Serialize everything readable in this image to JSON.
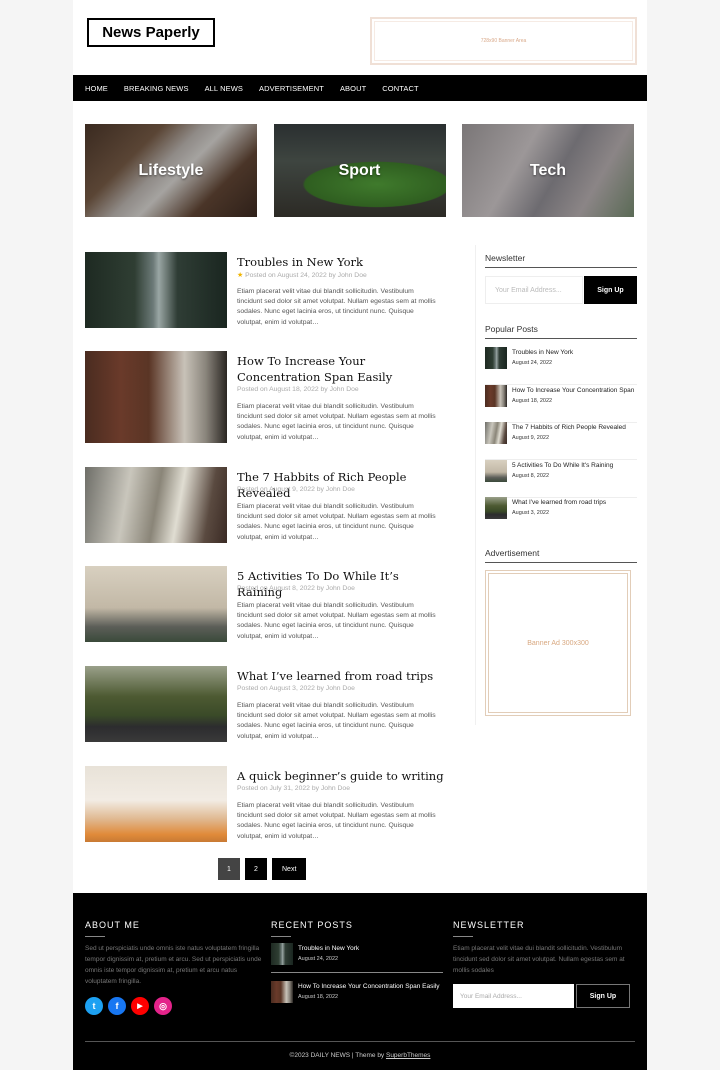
{
  "header": {
    "logo": "News Paperly",
    "banner_text": "728x90 Banner Area"
  },
  "nav": {
    "items": [
      "HOME",
      "BREAKING NEWS",
      "ALL NEWS",
      "ADVERTISEMENT",
      "ABOUT",
      "CONTACT"
    ]
  },
  "categories": [
    {
      "label": "Lifestyle"
    },
    {
      "label": "Sport"
    },
    {
      "label": "Tech"
    }
  ],
  "posts": [
    {
      "title": "Troubles in New York",
      "meta": "Posted on August 24, 2022 by John Doe",
      "featured": true,
      "excerpt": "Etiam placerat velit vitae dui blandit sollicitudin. Vestibulum tincidunt sed dolor sit amet volutpat. Nullam egestas sem at mollis sodales. Nunc eget lacinia eros, ut tincidunt nunc. Quisque volutpat, enim id volutpat…"
    },
    {
      "title": "How To Increase Your Concentration Span Easily",
      "meta": "Posted on August 18, 2022 by John Doe",
      "featured": false,
      "excerpt": "Etiam placerat velit vitae dui blandit sollicitudin. Vestibulum tincidunt sed dolor sit amet volutpat. Nullam egestas sem at mollis sodales. Nunc eget lacinia eros, ut tincidunt nunc. Quisque volutpat, enim id volutpat…"
    },
    {
      "title": "The 7 Habbits of Rich People Revealed",
      "meta": "Posted on August 9, 2022 by John Doe",
      "featured": false,
      "excerpt": "Etiam placerat velit vitae dui blandit sollicitudin. Vestibulum tincidunt sed dolor sit amet volutpat. Nullam egestas sem at mollis sodales. Nunc eget lacinia eros, ut tincidunt nunc. Quisque volutpat, enim id volutpat…"
    },
    {
      "title": "5 Activities To Do While It’s Raining",
      "meta": "Posted on August 8, 2022 by John Doe",
      "featured": false,
      "excerpt": "Etiam placerat velit vitae dui blandit sollicitudin. Vestibulum tincidunt sed dolor sit amet volutpat. Nullam egestas sem at mollis sodales. Nunc eget lacinia eros, ut tincidunt nunc. Quisque volutpat, enim id volutpat…"
    },
    {
      "title": "What I’ve learned from road trips",
      "meta": "Posted on August 3, 2022 by John Doe",
      "featured": false,
      "excerpt": "Etiam placerat velit vitae dui blandit sollicitudin. Vestibulum tincidunt sed dolor sit amet volutpat. Nullam egestas sem at mollis sodales. Nunc eget lacinia eros, ut tincidunt nunc. Quisque volutpat, enim id volutpat…"
    },
    {
      "title": "A quick beginner’s guide to writing",
      "meta": "Posted on July 31, 2022 by John Doe",
      "featured": false,
      "excerpt": "Etiam placerat velit vitae dui blandit sollicitudin. Vestibulum tincidunt sed dolor sit amet volutpat. Nullam egestas sem at mollis sodales. Nunc eget lacinia eros, ut tincidunt nunc. Quisque volutpat, enim id volutpat…"
    }
  ],
  "pagination": {
    "pages": [
      "1",
      "2"
    ],
    "current": "1",
    "next_label": "Next"
  },
  "sidebar": {
    "newsletter": {
      "title": "Newsletter",
      "placeholder": "Your Email Address...",
      "button": "Sign Up"
    },
    "popular": {
      "title": "Popular Posts",
      "items": [
        {
          "title": "Troubles in New York",
          "date": "August 24, 2022"
        },
        {
          "title": "How To Increase Your Concentration Span",
          "date": "August 18, 2022"
        },
        {
          "title": "The 7 Habbits of Rich People Revealed",
          "date": "August 9, 2022"
        },
        {
          "title": "5 Activities To Do While It's Raining",
          "date": "August 8, 2022"
        },
        {
          "title": "What I've learned from road trips",
          "date": "August 3, 2022"
        }
      ]
    },
    "advertisement": {
      "title": "Advertisement",
      "text": "Banner Ad 300x300"
    }
  },
  "footer": {
    "about": {
      "title": "ABOUT ME",
      "text": "Sed ut perspiciatis unde omnis iste natus voluptatem fringilla tempor dignissim at, pretium et arcu. Sed ut perspiciatis unde omnis iste tempor dignissim at, pretium et arcu natus voluptatem fringilla."
    },
    "socials": [
      {
        "name": "twitter",
        "glyph": "t"
      },
      {
        "name": "facebook",
        "glyph": "f"
      },
      {
        "name": "youtube",
        "glyph": "▶"
      },
      {
        "name": "instagram",
        "glyph": "◎"
      }
    ],
    "recent": {
      "title": "RECENT POSTS",
      "items": [
        {
          "title": "Troubles in New York",
          "date": "August 24, 2022"
        },
        {
          "title": "How To Increase Your Concentration Span Easily",
          "date": "August 18, 2022"
        }
      ]
    },
    "newsletter": {
      "title": "NEWSLETTER",
      "text": "Etiam placerat velit vitae dui blandit sollicitudin. Vestibulum tincidunt sed dolor sit amet volutpat. Nullam egestas sem at mollis sodales",
      "placeholder": "Your Email Address...",
      "button": "Sign Up"
    },
    "copyright_prefix": "©2023 DAILY NEWS | Theme by ",
    "copyright_link": "SuperbThemes"
  },
  "colors": {
    "accent_star": "#f0b400",
    "banner_text": "#d9a98a",
    "twitter": "#1da1f2",
    "facebook": "#1877f2",
    "youtube": "#ff0000",
    "instagram": "#e4238a"
  }
}
